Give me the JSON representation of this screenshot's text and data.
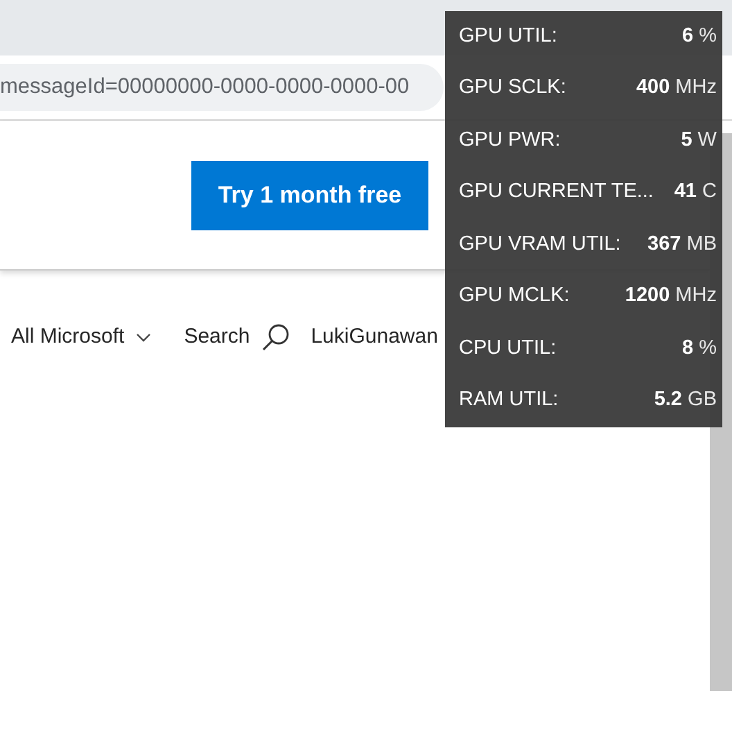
{
  "address_bar": {
    "url": "messageId=00000000-0000-0000-0000-00"
  },
  "banner": {
    "button": "Try 1 month free"
  },
  "nav": {
    "menu": "All Microsoft",
    "search": "Search",
    "user": "LukiGunawan"
  },
  "overlay": {
    "stats": [
      {
        "label": "GPU UTIL:",
        "value": "6",
        "unit": "%"
      },
      {
        "label": "GPU SCLK:",
        "value": "400",
        "unit": "MHz"
      },
      {
        "label": "GPU PWR:",
        "value": "5",
        "unit": "W"
      },
      {
        "label": "GPU CURRENT TE...",
        "value": "41",
        "unit": "C"
      },
      {
        "label": "GPU VRAM UTIL:",
        "value": "367",
        "unit": "MB"
      },
      {
        "label": "GPU MCLK:",
        "value": "1200",
        "unit": "MHz"
      },
      {
        "label": "CPU UTIL:",
        "value": "8",
        "unit": "%"
      },
      {
        "label": "RAM UTIL:",
        "value": "5.2",
        "unit": "GB"
      }
    ]
  }
}
